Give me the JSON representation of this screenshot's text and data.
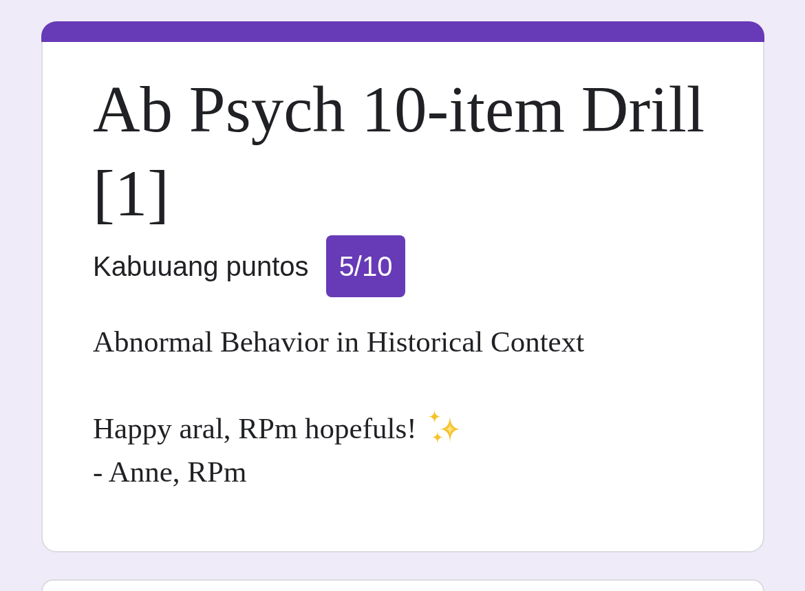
{
  "form": {
    "title": "Ab Psych 10-item Drill [1]",
    "score": {
      "label": "Kabuuang puntos",
      "value": "5/10"
    },
    "description": [
      {
        "lines": [
          {
            "text": "Abnormal Behavior in Historical Context",
            "emoji": false
          }
        ]
      },
      {
        "lines": [
          {
            "text": "Happy aral, RPm hopefuls!",
            "emoji": true
          },
          {
            "text": "- Anne, RPm",
            "emoji": false
          }
        ]
      }
    ]
  }
}
